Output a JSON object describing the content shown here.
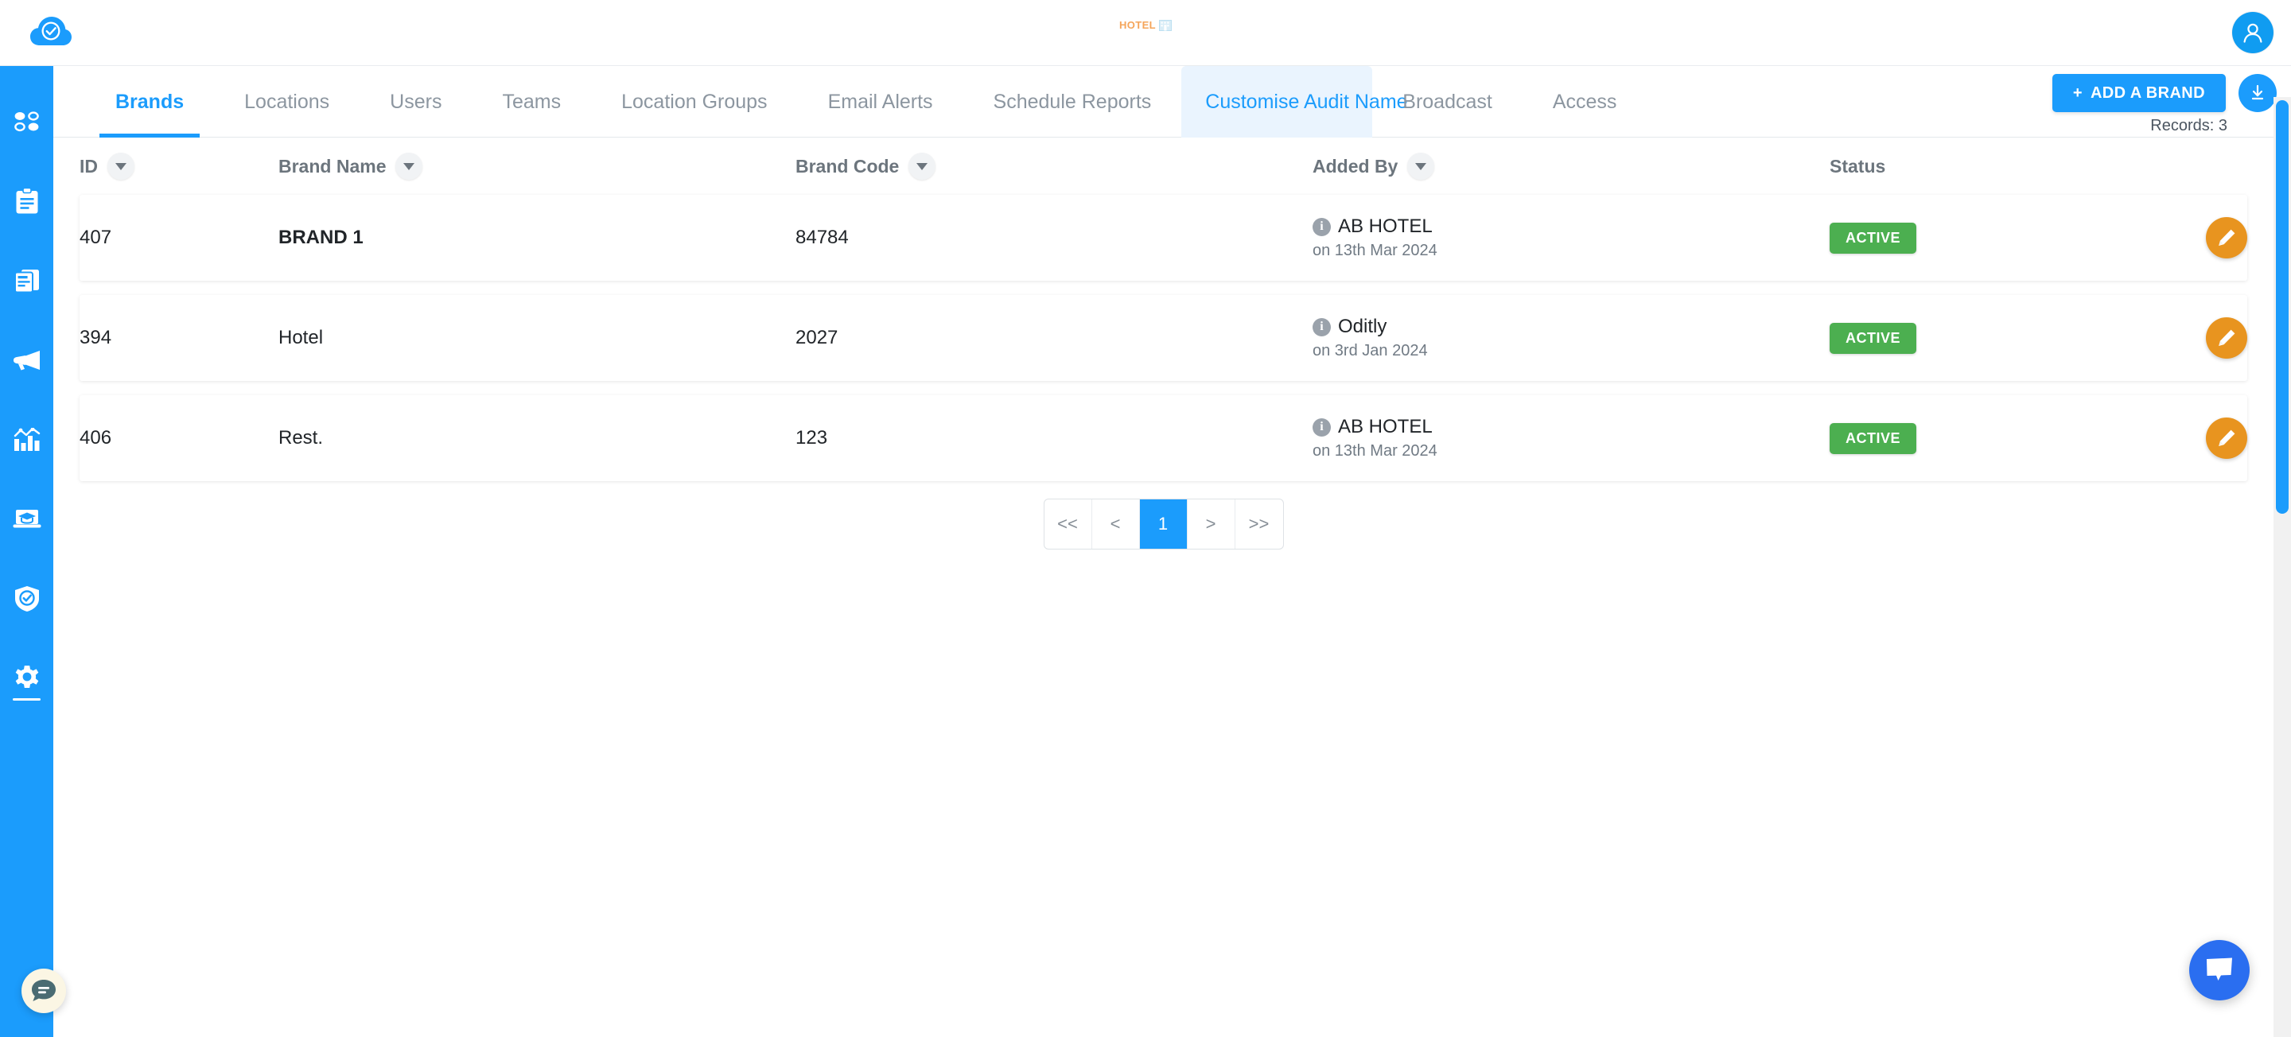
{
  "header": {
    "brand_logo_name": "cloud-check-logo",
    "center_logo_text": "HOTEL",
    "avatar_name": "user-avatar"
  },
  "sidebar": {
    "items": [
      {
        "icon": "dashboard-dots-icon",
        "name": "sidebar-item-dashboard",
        "active": false
      },
      {
        "icon": "clipboard-icon",
        "name": "sidebar-item-audits",
        "active": false
      },
      {
        "icon": "document-icon",
        "name": "sidebar-item-reports",
        "active": false
      },
      {
        "icon": "megaphone-icon",
        "name": "sidebar-item-broadcast",
        "active": false
      },
      {
        "icon": "bar-chart-icon",
        "name": "sidebar-item-analytics",
        "active": false
      },
      {
        "icon": "elearning-icon",
        "name": "sidebar-item-elearning",
        "active": false
      },
      {
        "icon": "shield-check-icon",
        "name": "sidebar-item-compliance",
        "active": false
      },
      {
        "icon": "gear-icon",
        "name": "sidebar-item-settings",
        "active": true
      }
    ],
    "chat_button": "chat-bubble-icon"
  },
  "tabs": [
    {
      "label": "Brands",
      "state": "active"
    },
    {
      "label": "Locations",
      "state": "normal"
    },
    {
      "label": "Users",
      "state": "normal"
    },
    {
      "label": "Teams",
      "state": "normal"
    },
    {
      "label": "Location Groups",
      "state": "normal"
    },
    {
      "label": "Email Alerts",
      "state": "normal"
    },
    {
      "label": "Schedule Reports",
      "state": "normal"
    },
    {
      "label": "Customise Audit Name",
      "state": "hovered"
    },
    {
      "label": "Broadcast",
      "state": "normal"
    },
    {
      "label": "Access",
      "state": "normal"
    }
  ],
  "toolbar": {
    "add_brand_label": "ADD A BRAND",
    "add_brand_plus": "+",
    "download_icon": "download-icon",
    "records_label": "Records: 3"
  },
  "table": {
    "columns": [
      {
        "label": "ID",
        "sortable": true
      },
      {
        "label": "Brand Name",
        "sortable": true
      },
      {
        "label": "Brand Code",
        "sortable": true
      },
      {
        "label": "Added By",
        "sortable": true
      },
      {
        "label": "Status",
        "sortable": false
      }
    ],
    "rows": [
      {
        "id": "407",
        "brand_name": "BRAND 1",
        "brand_name_bold": true,
        "brand_code": "84784",
        "added_by": "AB HOTEL",
        "added_on": "on 13th Mar 2024",
        "status": "ACTIVE",
        "status_color": "#4caf50",
        "action": "edit-button"
      },
      {
        "id": "394",
        "brand_name": "Hotel",
        "brand_name_bold": false,
        "brand_code": "2027",
        "added_by": "Oditly",
        "added_on": "on 3rd Jan 2024",
        "status": "ACTIVE",
        "status_color": "#4caf50",
        "action": "edit-button"
      },
      {
        "id": "406",
        "brand_name": "Rest.",
        "brand_name_bold": false,
        "brand_code": "123",
        "added_by": "AB HOTEL",
        "added_on": "on 13th Mar 2024",
        "status": "ACTIVE",
        "status_color": "#4caf50",
        "action": "edit-button"
      }
    ]
  },
  "pagination": {
    "first": "<<",
    "prev": "<",
    "pages": [
      "1"
    ],
    "current_page": "1",
    "next": ">",
    "last": ">>"
  },
  "floating": {
    "chat_icon": "chat-bubble-icon"
  },
  "colors": {
    "accent_blue": "#1b9cfc",
    "sidebar_blue": "#1b9cfc",
    "status_green": "#4caf50",
    "edit_orange": "#e8941f",
    "logo_orange": "#f5a55a",
    "chat_blue": "#2a6ef0"
  }
}
